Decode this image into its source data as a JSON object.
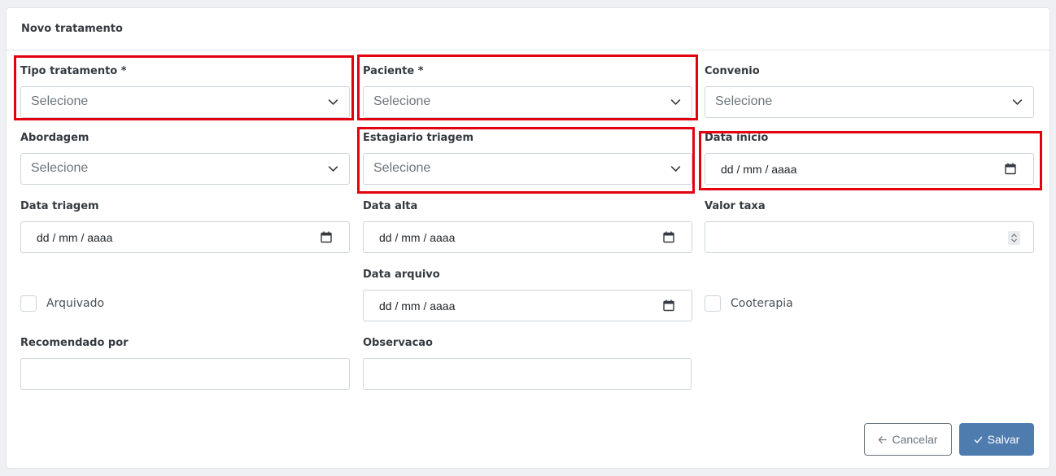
{
  "form": {
    "title": "Novo tratamento",
    "fields": {
      "tipo_tratamento": {
        "label": "Tipo tratamento *",
        "value": "Selecione"
      },
      "paciente": {
        "label": "Paciente *",
        "value": "Selecione"
      },
      "convenio": {
        "label": "Convenio",
        "value": "Selecione"
      },
      "abordagem": {
        "label": "Abordagem",
        "value": "Selecione"
      },
      "estagiario_triagem": {
        "label": "Estagiario triagem",
        "value": "Selecione"
      },
      "data_inicio": {
        "label": "Data inicio",
        "value": "dd / mm / aaaa"
      },
      "data_triagem": {
        "label": "Data triagem",
        "value": "dd / mm / aaaa"
      },
      "data_alta": {
        "label": "Data alta",
        "value": "dd / mm / aaaa"
      },
      "valor_taxa": {
        "label": "Valor taxa",
        "value": ""
      },
      "arquivado": {
        "label": "Arquivado",
        "checked": false
      },
      "data_arquivo": {
        "label": "Data arquivo",
        "value": "dd / mm / aaaa"
      },
      "cooterapia": {
        "label": "Cooterapia",
        "checked": false
      },
      "recomendado_por": {
        "label": "Recomendado por",
        "value": ""
      },
      "observacao": {
        "label": "Observacao",
        "value": ""
      }
    },
    "buttons": {
      "cancel": {
        "label": "Cancelar",
        "icon": "arrow-left-icon"
      },
      "save": {
        "label": "Salvar",
        "icon": "check-icon"
      }
    }
  },
  "colors": {
    "highlight": "#e3000f",
    "primary": "#4e7caf",
    "secondary": "#6c757d"
  }
}
